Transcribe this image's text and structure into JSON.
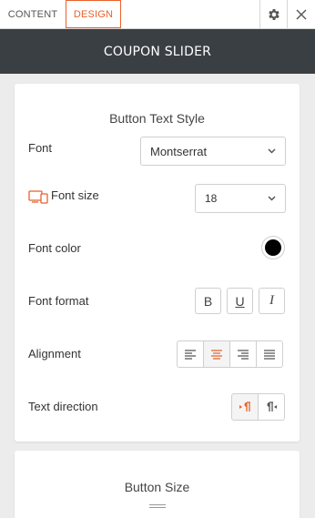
{
  "tabs": {
    "content": "CONTENT",
    "design": "DESIGN"
  },
  "header": {
    "title": "COUPON SLIDER"
  },
  "colors": {
    "accent": "#e8622c",
    "dark_bar": "#3a3f44",
    "font_color": "#000000"
  },
  "icons": {
    "settings": "gear-icon",
    "close": "close-icon",
    "device": "device-icon"
  },
  "button_text_style": {
    "title": "Button Text Style",
    "font": {
      "label": "Font",
      "value": "Montserrat"
    },
    "font_size": {
      "label": "Font size",
      "value": "18"
    },
    "font_color": {
      "label": "Font color"
    },
    "font_format": {
      "label": "Font format",
      "options": [
        "B",
        "U",
        "I"
      ]
    },
    "alignment": {
      "label": "Alignment",
      "options": [
        "left",
        "center",
        "right",
        "justify"
      ],
      "selected": "center"
    },
    "text_direction": {
      "label": "Text direction",
      "options": [
        "ltr",
        "rtl"
      ],
      "selected": "ltr"
    }
  },
  "button_size": {
    "title": "Button Size"
  }
}
